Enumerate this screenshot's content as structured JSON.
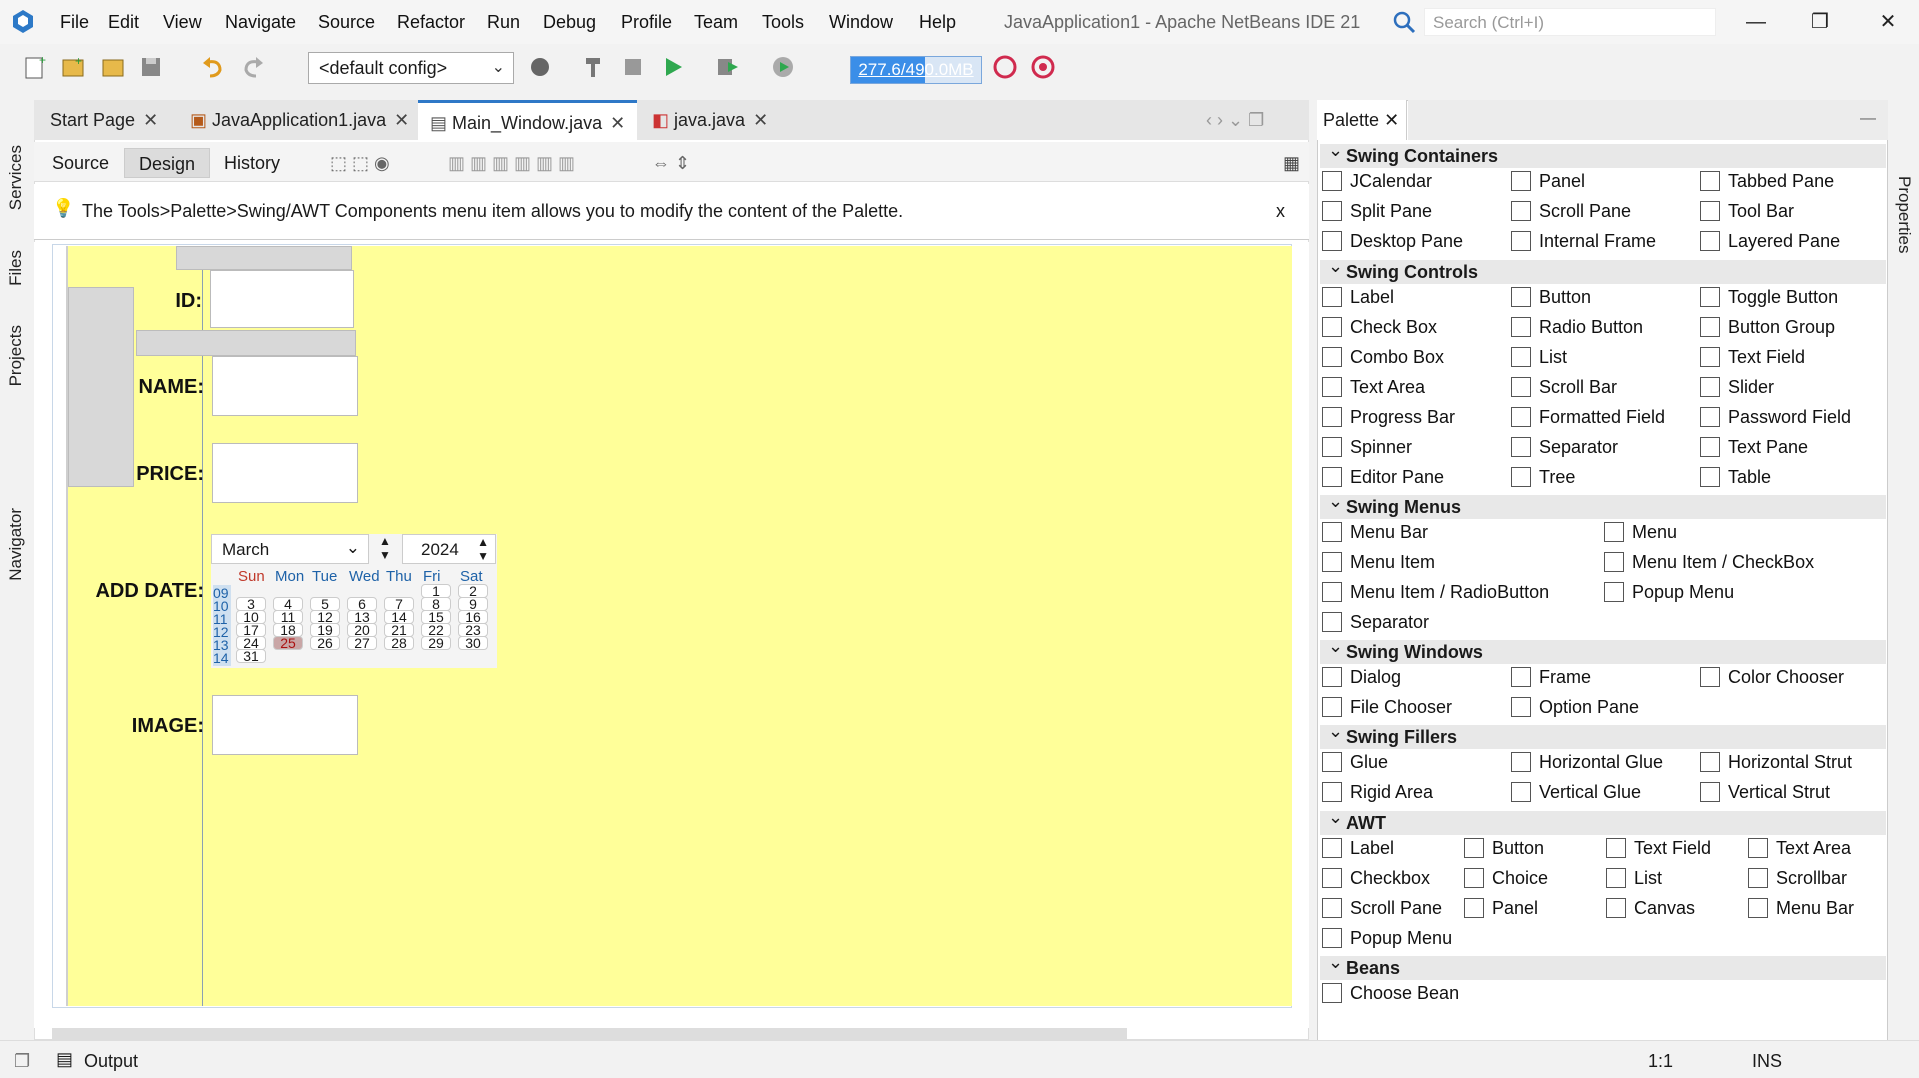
{
  "window": {
    "title": "JavaApplication1 - Apache NetBeans IDE 21",
    "search_placeholder": "Search (Ctrl+I)"
  },
  "menu": [
    "File",
    "Edit",
    "View",
    "Navigate",
    "Source",
    "Refactor",
    "Run",
    "Debug",
    "Profile",
    "Team",
    "Tools",
    "Window",
    "Help"
  ],
  "toolbar": {
    "config": "<default config>",
    "memory": "277.6/490.0MB",
    "memory_fraction": 0.566
  },
  "left_rail": [
    "Services",
    "Files",
    "Projects",
    "Navigator"
  ],
  "right_rail": [
    "Properties"
  ],
  "tabs": [
    {
      "label": "Start Page"
    },
    {
      "label": "JavaApplication1.java"
    },
    {
      "label": "Main_Window.java"
    },
    {
      "label": "java.java"
    }
  ],
  "subtabs": [
    "Source",
    "Design",
    "History"
  ],
  "info": {
    "text": "The Tools>Palette>Swing/AWT Components menu item allows you to modify the content of the Palette.",
    "close": "x"
  },
  "form": {
    "labels": {
      "id": "ID:",
      "name": "NAME:",
      "price": "PRICE:",
      "add_date": "ADD DATE:",
      "image": "IMAGE:"
    },
    "calendar": {
      "month": "March",
      "year": "2024",
      "days": [
        "Sun",
        "Mon",
        "Tue",
        "Wed",
        "Thu",
        "Fri",
        "Sat"
      ],
      "weeks": [
        "09",
        "10",
        "11",
        "12",
        "13",
        "14"
      ],
      "rows": [
        [
          "",
          "",
          "",
          "",
          "",
          "1",
          "2"
        ],
        [
          "3",
          "4",
          "5",
          "6",
          "7",
          "8",
          "9"
        ],
        [
          "10",
          "11",
          "12",
          "13",
          "14",
          "15",
          "16"
        ],
        [
          "17",
          "18",
          "19",
          "20",
          "21",
          "22",
          "23"
        ],
        [
          "24",
          "25",
          "26",
          "27",
          "28",
          "29",
          "30"
        ],
        [
          "31",
          "",
          "",
          "",
          "",
          "",
          ""
        ]
      ],
      "selected": "25"
    }
  },
  "palette": {
    "title": "Palette",
    "categories": {
      "swing_containers": "Swing Containers",
      "swing_controls": "Swing Controls",
      "swing_menus": "Swing Menus",
      "swing_windows": "Swing Windows",
      "swing_fillers": "Swing Fillers",
      "awt": "AWT",
      "beans": "Beans"
    },
    "containers": [
      "JCalendar",
      "Panel",
      "Tabbed Pane",
      "Split Pane",
      "Scroll Pane",
      "Tool Bar",
      "Desktop Pane",
      "Internal Frame",
      "Layered Pane"
    ],
    "controls": [
      "Label",
      "Button",
      "Toggle Button",
      "Check Box",
      "Radio Button",
      "Button Group",
      "Combo Box",
      "List",
      "Text Field",
      "Text Area",
      "Scroll Bar",
      "Slider",
      "Progress Bar",
      "Formatted Field",
      "Password Field",
      "Spinner",
      "Separator",
      "Text Pane",
      "Editor Pane",
      "Tree",
      "Table"
    ],
    "menus": [
      "Menu Bar",
      "Menu",
      "Menu Item",
      "Menu Item / CheckBox",
      "Menu Item / RadioButton",
      "Popup Menu",
      "Separator"
    ],
    "windows": [
      "Dialog",
      "Frame",
      "Color Chooser",
      "File Chooser",
      "Option Pane"
    ],
    "fillers": [
      "Glue",
      "Horizontal Glue",
      "Horizontal Strut",
      "Rigid Area",
      "Vertical Glue",
      "Vertical Strut"
    ],
    "awt": [
      "Label",
      "Button",
      "Text Field",
      "Text Area",
      "Checkbox",
      "Choice",
      "List",
      "Scrollbar",
      "Scroll Pane",
      "Panel",
      "Canvas",
      "Menu Bar",
      "Popup Menu"
    ],
    "beans": [
      "Choose Bean"
    ]
  },
  "status": {
    "output": "Output",
    "position": "1:1",
    "mode": "INS"
  }
}
